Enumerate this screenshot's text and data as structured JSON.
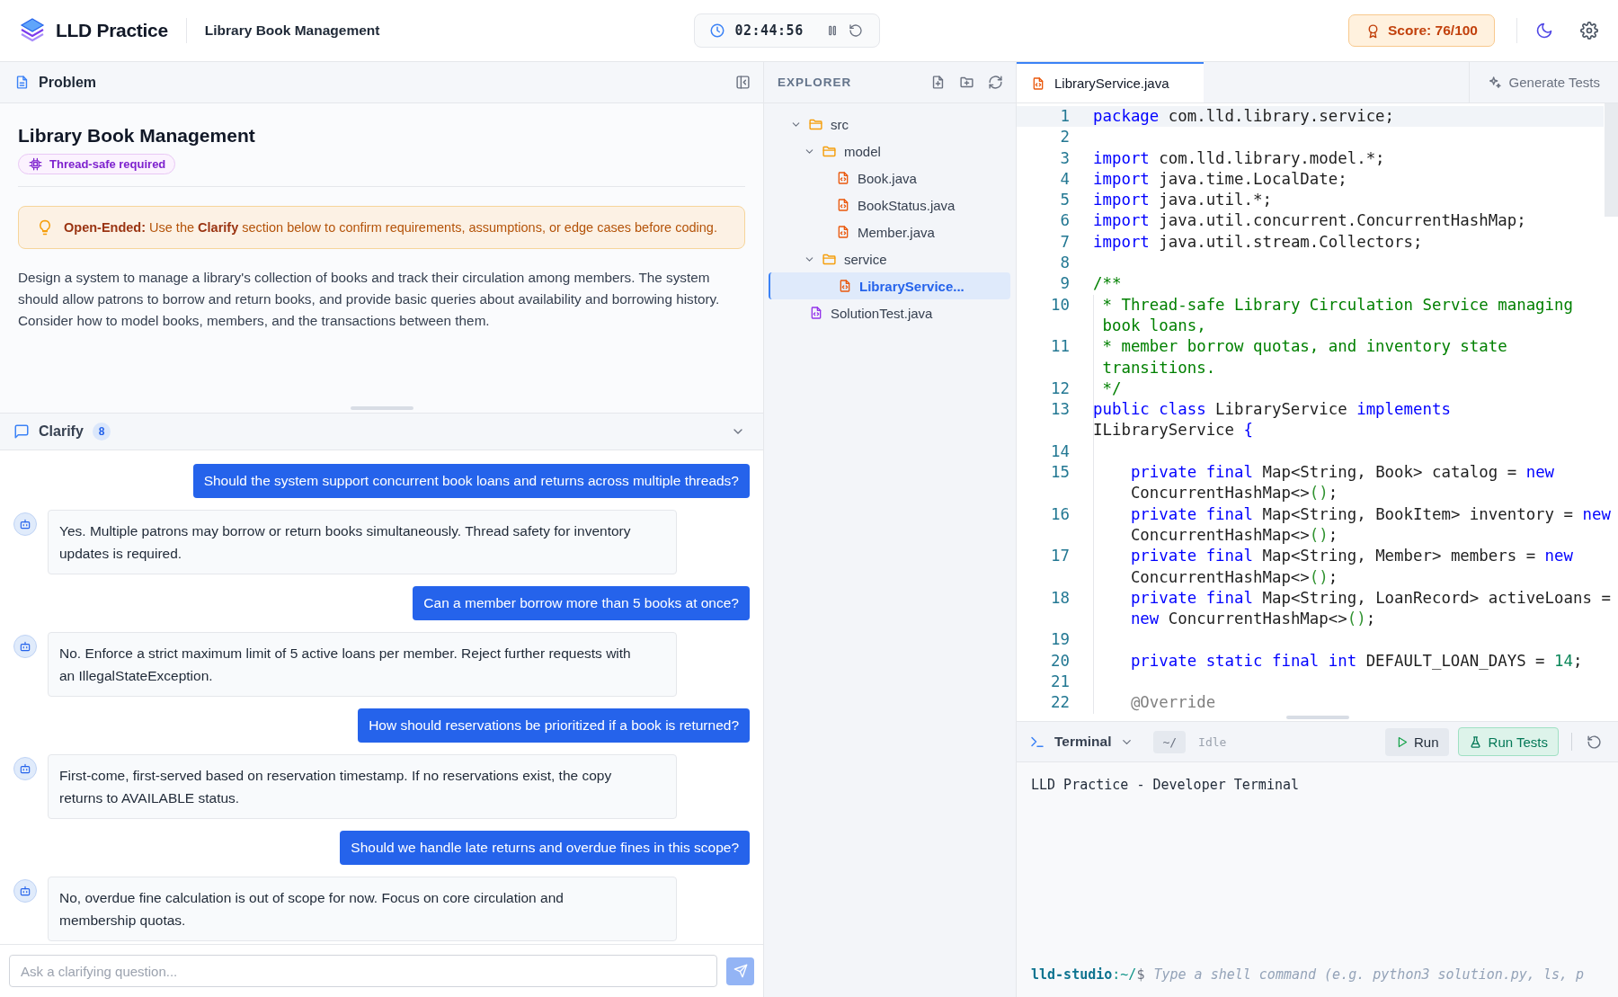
{
  "header": {
    "app_name": "LLD Practice",
    "problem_title": "Library Book Management",
    "timer": "02:44:56",
    "score": "Score: 76/100"
  },
  "problem": {
    "panel_title": "Problem",
    "title": "Library Book Management",
    "badge": "Thread-safe required",
    "notice": "**Open-Ended:** Use the **Clarify** section below to confirm requirements, assumptions, or edge cases before coding.",
    "description": "Design a system to manage a library's collection of books and track their circulation among members. The system should allow patrons to borrow and return books, and provide basic queries about availability and borrowing history. Consider how to model books, members, and the transactions between them."
  },
  "clarify": {
    "title": "Clarify",
    "count": "8",
    "expanded": true,
    "messages": [
      {
        "kind": "user",
        "text": "Should the system support concurrent book loans and returns across multiple threads?"
      },
      {
        "kind": "assistant",
        "text": "Yes. Multiple patrons may borrow or return books simultaneously. Thread safety for inventory updates is required."
      },
      {
        "kind": "user",
        "text": "Can a member borrow more than 5 books at once?"
      },
      {
        "kind": "assistant",
        "text": "No. Enforce a strict maximum limit of 5 active loans per member. Reject further requests with an IllegalStateException."
      },
      {
        "kind": "user",
        "text": "How should reservations be prioritized if a book is returned?"
      },
      {
        "kind": "assistant",
        "text": "First-come, first-served based on reservation timestamp. If no reservations exist, the copy returns to AVAILABLE status."
      },
      {
        "kind": "user",
        "text": "Should we handle late returns and overdue fines in this scope?"
      },
      {
        "kind": "assistant",
        "text": "No, overdue fine calculation is out of scope for now. Focus on core circulation and membership quotas."
      }
    ],
    "input_placeholder": "Ask a clarifying question..."
  },
  "explorer": {
    "title": "EXPLORER",
    "tree": [
      {
        "name": "src",
        "kind": "folder",
        "expanded": true,
        "children": [
          {
            "name": "model",
            "kind": "folder",
            "expanded": true,
            "children": [
              {
                "name": "Book.java",
                "kind": "java",
                "selected": false
              },
              {
                "name": "BookStatus.java",
                "kind": "java",
                "selected": false
              },
              {
                "name": "Member.java",
                "kind": "java",
                "selected": false
              }
            ]
          },
          {
            "name": "service",
            "kind": "folder",
            "expanded": true,
            "children": [
              {
                "name": "LibraryService...",
                "kind": "java",
                "selected": true
              }
            ]
          }
        ]
      },
      {
        "name": "SolutionTest.java",
        "kind": "test",
        "selected": false
      }
    ]
  },
  "editor": {
    "tabs": [
      {
        "label": "LibraryService.java",
        "selected": true
      }
    ],
    "generate_button": "Generate Tests",
    "lines": [
      {
        "number": "1",
        "current": true,
        "segments": [
          {
            "kind": "kw",
            "text": "package"
          },
          {
            "kind": "plain",
            "text": " com.lld.library.service;"
          }
        ]
      },
      {
        "number": "2",
        "current": false
      },
      {
        "number": "3",
        "current": false,
        "segments": [
          {
            "kind": "kw",
            "text": "import"
          },
          {
            "kind": "plain",
            "text": " com.lld.library.model.*;"
          }
        ]
      },
      {
        "number": "4",
        "current": false,
        "segments": [
          {
            "kind": "kw",
            "text": "import"
          },
          {
            "kind": "plain",
            "text": " java.time.LocalDate;"
          }
        ]
      },
      {
        "number": "5",
        "current": false,
        "segments": [
          {
            "kind": "kw",
            "text": "import"
          },
          {
            "kind": "plain",
            "text": " java.util.*;"
          }
        ]
      },
      {
        "number": "6",
        "current": false,
        "segments": [
          {
            "kind": "kw",
            "text": "import"
          },
          {
            "kind": "plain",
            "text": " java.util.concurrent.ConcurrentHashMap;"
          }
        ]
      },
      {
        "number": "7",
        "current": false,
        "segments": [
          {
            "kind": "kw",
            "text": "import"
          },
          {
            "kind": "plain",
            "text": " java.util.stream.Collectors;"
          }
        ]
      },
      {
        "number": "8",
        "current": false
      },
      {
        "number": "9",
        "current": false,
        "segments": [
          {
            "kind": "comment",
            "text": "/**"
          }
        ]
      },
      {
        "number": "10",
        "current": false,
        "segments": [
          {
            "kind": "comment",
            "text": " * Thread-safe Library Circulation Service managing book loans,"
          }
        ]
      },
      {
        "number": "11",
        "current": false,
        "segments": [
          {
            "kind": "comment",
            "text": " * member borrow quotas, and inventory state transitions."
          }
        ]
      },
      {
        "number": "12",
        "current": false,
        "segments": [
          {
            "kind": "comment",
            "text": " */"
          }
        ]
      },
      {
        "number": "13",
        "current": false,
        "segments": [
          {
            "kind": "kw",
            "text": "public class"
          },
          {
            "kind": "plain",
            "text": " LibraryService "
          },
          {
            "kind": "kw",
            "text": "implements"
          },
          {
            "kind": "plain",
            "text": " ILibraryService "
          },
          {
            "kind": "brace",
            "text": "{"
          }
        ]
      },
      {
        "number": "14",
        "current": false
      },
      {
        "number": "15",
        "current": false,
        "segments": [
          {
            "kind": "kw",
            "text": "    private final"
          },
          {
            "kind": "plain",
            "text": " Map<String, Book> catalog = "
          },
          {
            "kind": "kw",
            "text": "new"
          },
          {
            "kind": "plain",
            "text": " ConcurrentHashMap<>"
          },
          {
            "kind": "paren",
            "text": "()"
          },
          {
            "kind": "plain",
            "text": ";"
          }
        ]
      },
      {
        "number": "16",
        "current": false,
        "segments": [
          {
            "kind": "kw",
            "text": "    private final"
          },
          {
            "kind": "plain",
            "text": " Map<String, BookItem> inventory = "
          },
          {
            "kind": "kw",
            "text": "new"
          },
          {
            "kind": "plain",
            "text": " ConcurrentHashMap<>"
          },
          {
            "kind": "paren",
            "text": "()"
          },
          {
            "kind": "plain",
            "text": ";"
          }
        ]
      },
      {
        "number": "17",
        "current": false,
        "segments": [
          {
            "kind": "kw",
            "text": "    private final"
          },
          {
            "kind": "plain",
            "text": " Map<String, Member> members = "
          },
          {
            "kind": "kw",
            "text": "new"
          },
          {
            "kind": "plain",
            "text": " ConcurrentHashMap<>"
          },
          {
            "kind": "paren",
            "text": "()"
          },
          {
            "kind": "plain",
            "text": ";"
          }
        ]
      },
      {
        "number": "18",
        "current": false,
        "segments": [
          {
            "kind": "kw",
            "text": "    private final"
          },
          {
            "kind": "plain",
            "text": " Map<String, LoanRecord> activeLoans = "
          },
          {
            "kind": "kw",
            "text": "new"
          },
          {
            "kind": "plain",
            "text": " ConcurrentHashMap<>"
          },
          {
            "kind": "paren",
            "text": "()"
          },
          {
            "kind": "plain",
            "text": ";"
          }
        ]
      },
      {
        "number": "19",
        "current": false
      },
      {
        "number": "20",
        "current": false,
        "segments": [
          {
            "kind": "kw",
            "text": "    private static final int"
          },
          {
            "kind": "plain",
            "text": " DEFAULT_LOAN_DAYS = "
          },
          {
            "kind": "num",
            "text": "14"
          },
          {
            "kind": "plain",
            "text": ";"
          }
        ]
      },
      {
        "number": "21",
        "current": false
      },
      {
        "number": "22",
        "current": false,
        "segments": [
          {
            "kind": "annotation",
            "text": "    @Override"
          }
        ]
      }
    ]
  },
  "terminal": {
    "title": "Terminal",
    "path": "~/",
    "status": "Idle",
    "run_button": "Run",
    "tests_button": "Run Tests",
    "output": "LLD Practice - Developer Terminal",
    "prompt_host": "lld-studio",
    "prompt_path": ":~/",
    "prompt_symbol": "$",
    "placeholder": "Type a shell command (e.g. python3 solution.py, ls, p"
  }
}
